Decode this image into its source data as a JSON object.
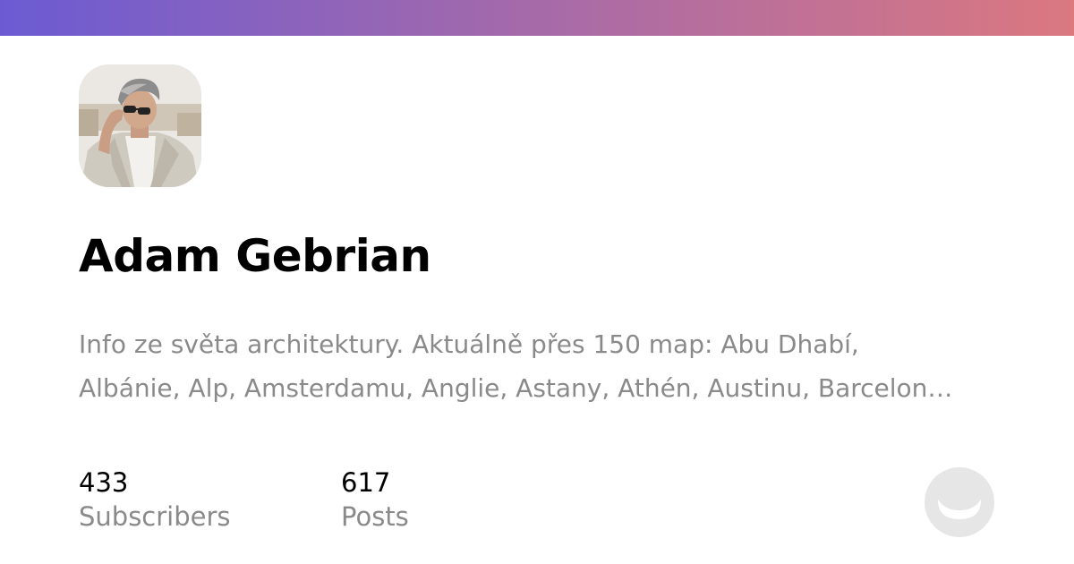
{
  "colors": {
    "gradient_start": "#6b5bd3",
    "gradient_mid": "#a66aa9",
    "gradient_end": "#db7880",
    "name": "#000000",
    "muted": "#8a8a8a",
    "logo": "#e6e6e6"
  },
  "profile": {
    "name": "Adam Gebrian",
    "bio": "Info ze světa architektury. Aktuálně přes 150 map: Abu Dhabí, Albánie, Alp, Amsterdamu, Anglie, Astany, Athén, Austinu, Barcelony, Basileje, Berlína, Bilbaa, Bratislavy, Brna, Bruselu...",
    "avatar_icon": "profile-photo"
  },
  "stats": {
    "subscribers": {
      "value": "433",
      "label": "Subscribers"
    },
    "posts": {
      "value": "617",
      "label": "Posts"
    }
  },
  "logo": {
    "icon": "smiley-icon"
  }
}
